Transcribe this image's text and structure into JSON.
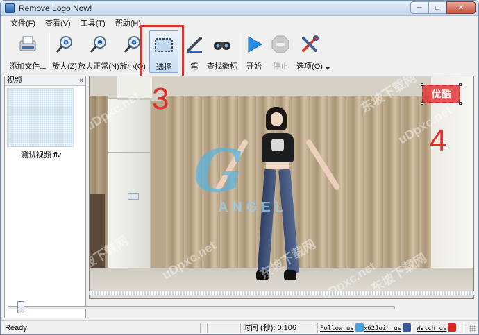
{
  "window": {
    "title": "Remove Logo Now!"
  },
  "menu": [
    "文件(F)",
    "查看(V)",
    "工具(T)",
    "帮助(H)"
  ],
  "toolbar": {
    "add_file": "添加文件...",
    "zoom_in": "放大(Z)",
    "zoom_normal": "放大正常(N)",
    "zoom_out": "放小(O)",
    "select": "选择",
    "pen": "笔",
    "find_logo": "查找徽标",
    "start": "开始",
    "stop": "停止",
    "options": "选项(O)"
  },
  "side_panel": {
    "title": "视频",
    "close": "×",
    "thumbnail_label": "测试视频.flv"
  },
  "video": {
    "logo_letter": "G",
    "logo_sub": "ANGEL",
    "selection_text": "优酷",
    "watermarks": [
      "东坡下载网",
      "uDpxc.net"
    ]
  },
  "annotations": {
    "step3": "3",
    "step4": "4"
  },
  "status": {
    "ready": "Ready",
    "time": "时间 (秒): 0.106",
    "follow": "Follow us",
    "join": "Join us",
    "watch": "Watch us",
    "counter": "x62"
  },
  "colors": {
    "annotation_red": "#e0302a",
    "selection_red": "#e4383a",
    "window_border": "#6d8fb3"
  },
  "icons": [
    "app-icon",
    "add-file-icon",
    "zoom-in-icon",
    "zoom-normal-icon",
    "zoom-out-icon",
    "select-icon",
    "pen-icon",
    "binoculars-icon",
    "play-icon",
    "stop-icon",
    "options-icon",
    "twitter-icon",
    "facebook-icon",
    "youtube-icon"
  ]
}
